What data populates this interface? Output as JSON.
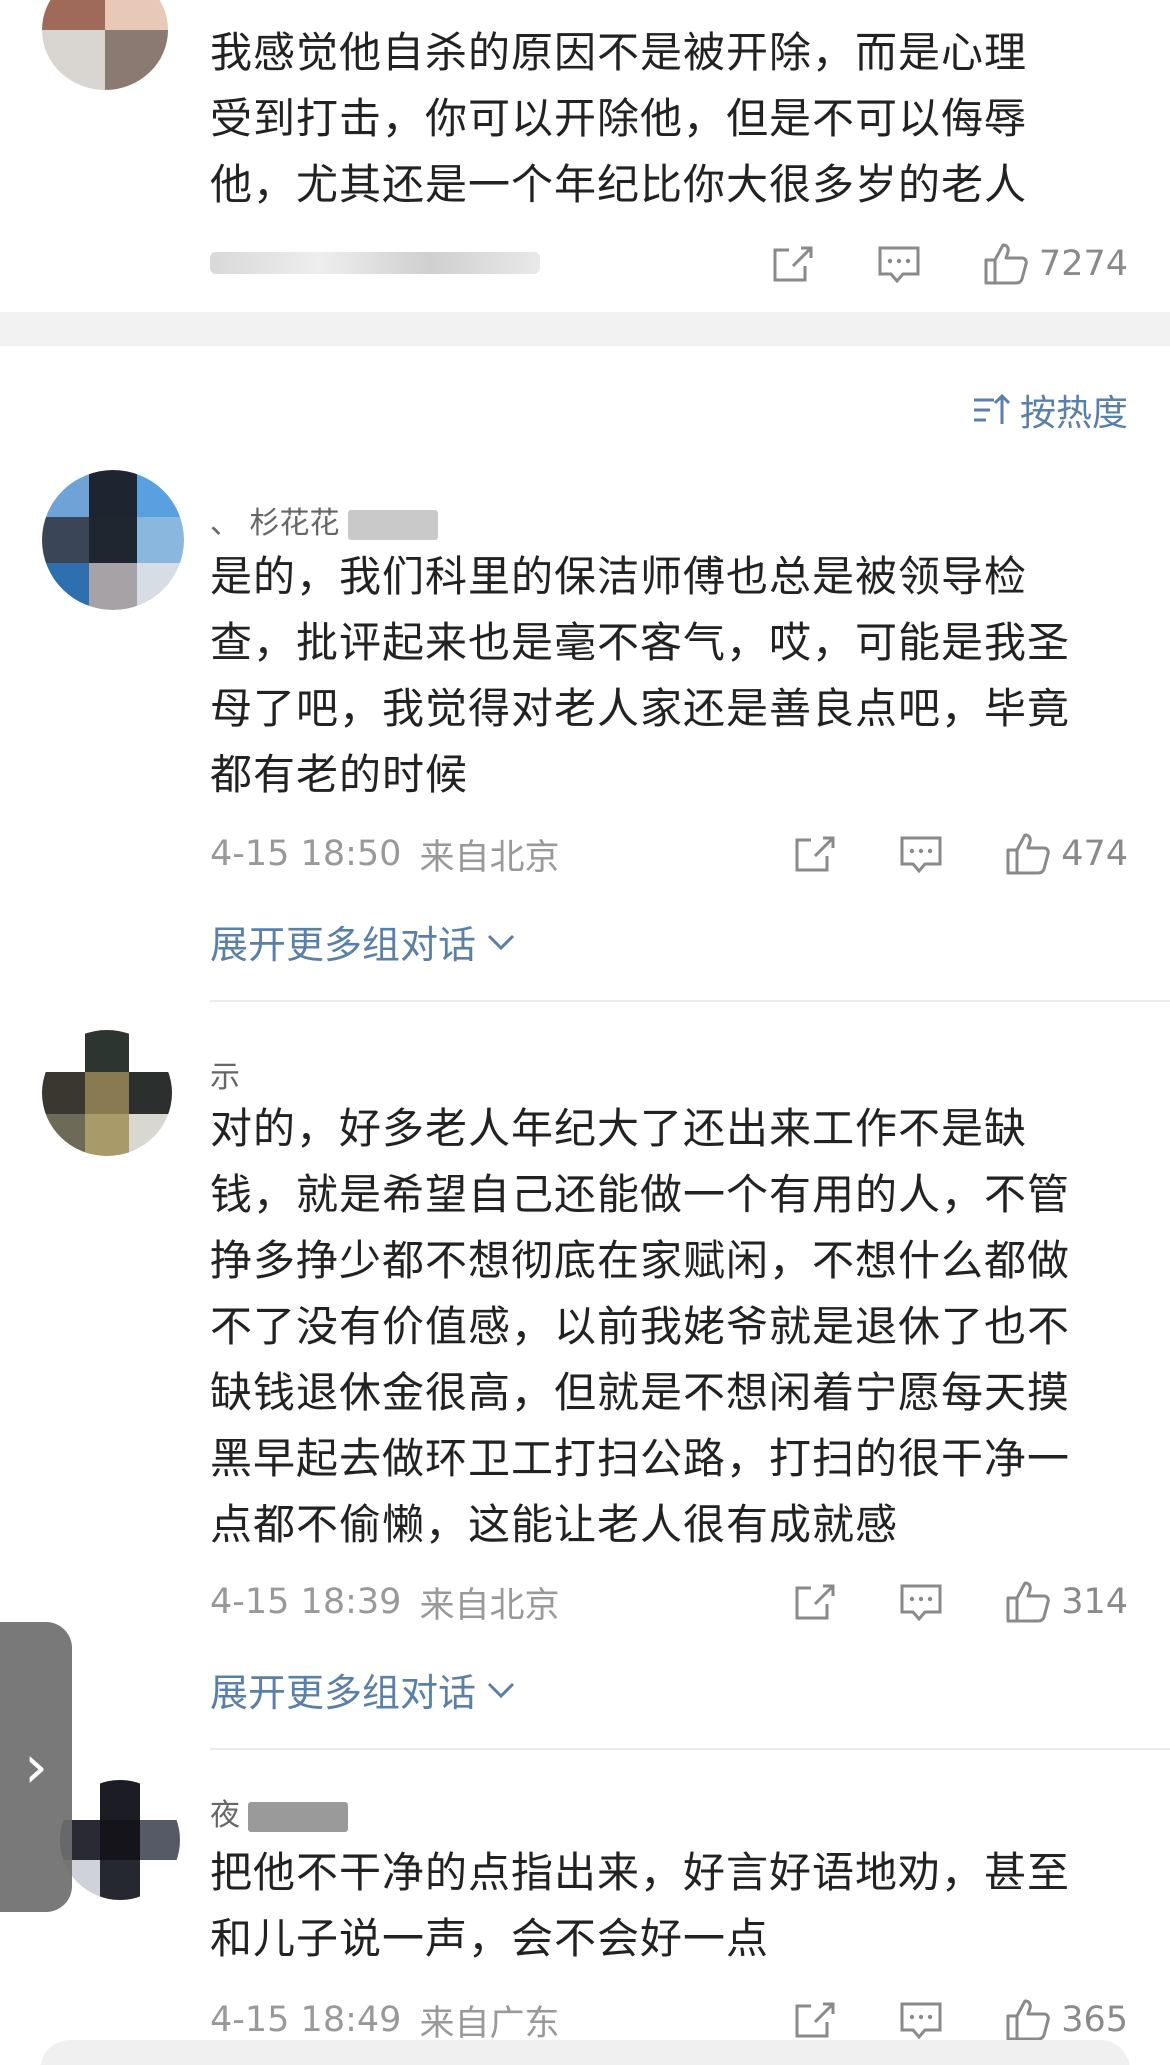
{
  "comments": [
    {
      "text_lines": [
        "我感觉他自杀的原因不是被开除，而是心理",
        "受到打击，你可以开除他，但是不可以侮辱",
        "他，尤其还是一个年纪比你大很多岁的老人"
      ],
      "likes": "7274"
    },
    {
      "username": "、 杉花花",
      "text_lines": [
        "是的，我们科里的保洁师傅也总是被领导检",
        "查，批评起来也是毫不客气，哎，可能是我圣",
        "母了吧，我觉得对老人家还是善良点吧，毕竟",
        "都有老的时候"
      ],
      "time": "4-15 18:50",
      "location": "来自北京",
      "likes": "474",
      "expand_label": "展开更多组对话"
    },
    {
      "username": "示",
      "text_lines": [
        "对的，好多老人年纪大了还出来工作不是缺",
        "钱，就是希望自己还能做一个有用的人，不管",
        "挣多挣少都不想彻底在家赋闲，不想什么都做",
        "不了没有价值感，以前我姥爷就是退休了也不",
        "缺钱退休金很高，但就是不想闲着宁愿每天摸",
        "黑早起去做环卫工打扫公路，打扫的很干净一",
        "点都不偷懒，这能让老人很有成就感"
      ],
      "time": "4-15 18:39",
      "location": "来自北京",
      "likes": "314",
      "expand_label": "展开更多组对话"
    },
    {
      "username": "夜",
      "text_lines": [
        "把他不干净的点指出来，好言好语地劝，甚至",
        "和儿子说一声，会不会好一点"
      ],
      "time": "4-15 18:49",
      "location": "来自广东",
      "likes": "365"
    }
  ],
  "sort_label": "按热度",
  "side_handle_glyph": "›",
  "colors": {
    "link": "#5a7fa8",
    "meta": "#999999",
    "icon": "#8a8a8a"
  },
  "icons": [
    "share-icon",
    "comment-icon",
    "like-icon",
    "sort-icon",
    "chevron-down-icon"
  ]
}
